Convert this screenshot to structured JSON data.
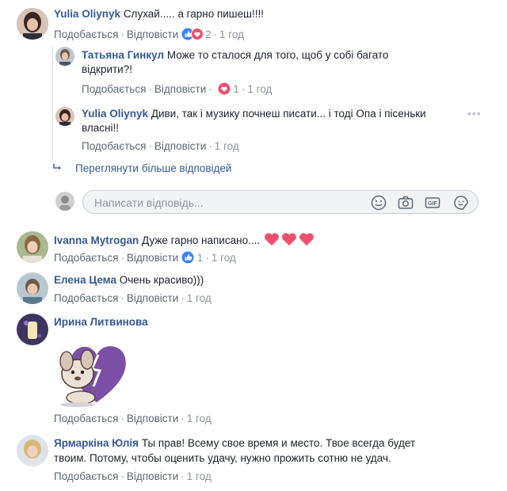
{
  "actions": {
    "like": "Подобається",
    "reply": "Відповісти",
    "sep": "·"
  },
  "comments": [
    {
      "author": "Yulia Oliynyk",
      "text": "Слухай..... а гарно пишеш!!!!",
      "reactions": "2",
      "time": "1 год"
    },
    {
      "author": "Ivanna Mytrogan",
      "text": "Дуже гарно написано....",
      "reactions": "1",
      "time": "1 год"
    },
    {
      "author": "Елена Цема",
      "text": "Очень красиво)))",
      "time": "1 год"
    },
    {
      "author": "Ирина Литвинова",
      "time": "1 год"
    },
    {
      "author": "Ярмаркіна Юлія",
      "text_line1": "Ты прав! Всему свое время и место. Твое всегда будет",
      "text_line2": "твоим. Потому, чтобы оценить удачу, нужно прожить сотню не удач.",
      "time": "1 год"
    }
  ],
  "replies": [
    {
      "author": "Татьяна Гинкул",
      "text_line1": "Може то сталося для того, щоб у собі багато",
      "text_line2": "відкрити?!",
      "reactions": "1",
      "time": "1 год"
    },
    {
      "author": "Yulia Oliynyk",
      "text_line1": "Диви, так і музику почнеш писати... і тоді Опа і пісеньки",
      "text_line2": "власні!!",
      "time": "1 год"
    }
  ],
  "view_more": "Переглянути більше відповідей",
  "reply_placeholder": "Написати відповідь...",
  "more_dots": "•••",
  "colors": {
    "name": "#365899",
    "heart": "#f0506e",
    "like": "#4080ff",
    "purple_sticker": "#7b4fa6"
  },
  "icons": [
    "smiley-icon",
    "camera-icon",
    "gif-icon",
    "sticker-icon",
    "like-reaction-icon",
    "heart-reaction-icon",
    "reply-arrow-icon"
  ]
}
